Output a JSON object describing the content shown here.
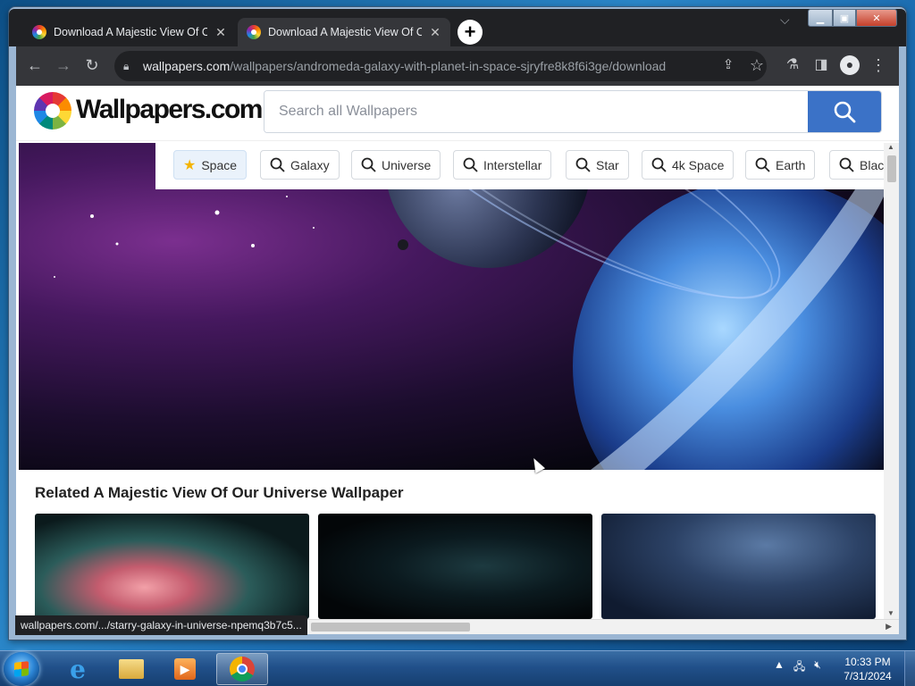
{
  "browser": {
    "tabs": [
      {
        "title": "Download A Majestic View Of Our Universe Wallpaper",
        "close": "✕"
      },
      {
        "title": "Download A Majestic View Of Our Universe Wallpaper",
        "close": "✕"
      }
    ],
    "new_tab": "+",
    "url_domain": "wallpapers.com",
    "url_path": "/wallpapers/andromeda-galaxy-with-planet-in-space-sjryfre8k8f6i3ge/download",
    "status_url": "wallpapers.com/.../starry-galaxy-in-universe-npemq3b7c5..."
  },
  "site": {
    "logo": "Wallpapers.com",
    "search_placeholder": "Search all Wallpapers",
    "chips": [
      "Space",
      "Galaxy",
      "Universe",
      "Interstellar",
      "Star",
      "4k Space",
      "Earth",
      "Black"
    ],
    "related_title": "Related A Majestic View Of Our Universe Wallpaper"
  },
  "colors": {
    "accent": "#3b72c7",
    "chrome_dark": "#202124",
    "chrome_toolbar": "#35363a"
  },
  "taskbar": {
    "apps": [
      "internet-explorer-icon",
      "file-explorer-icon",
      "media-player-icon",
      "chrome-icon"
    ],
    "time": "10:33 PM",
    "date": "7/31/2024"
  }
}
